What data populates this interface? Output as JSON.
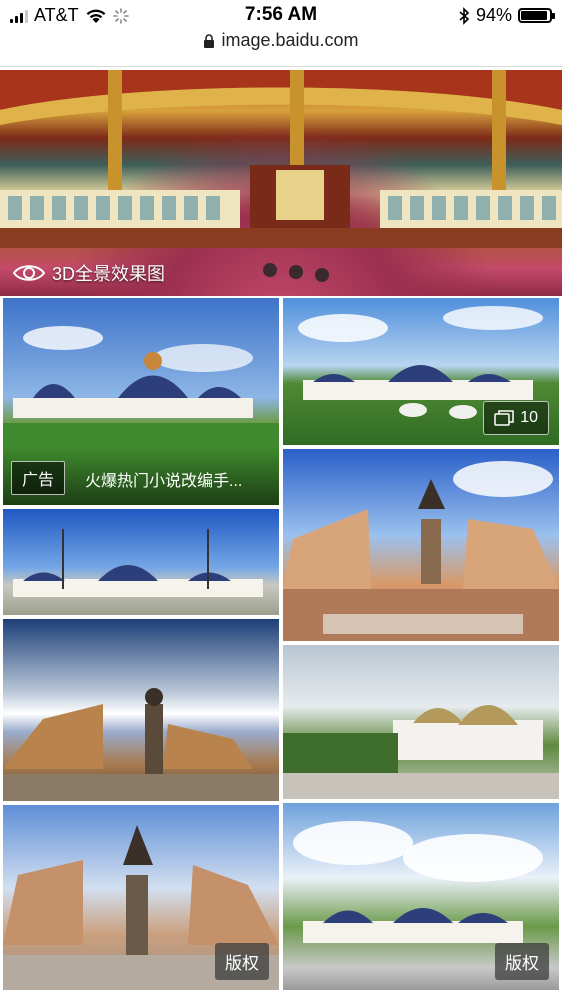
{
  "status_bar": {
    "carrier": "AT&T",
    "time": "7:56 AM",
    "battery": "94%",
    "battery_level": 0.94
  },
  "url_bar": {
    "url": "image.baidu.com"
  },
  "panorama": {
    "label": "3D全景效果图"
  },
  "tiles": {
    "ad": {
      "badge": "广告",
      "text": "火爆热门小说改编手..."
    },
    "gallery": {
      "count": "10"
    },
    "copyright_1": "版权",
    "copyright_2": "版权"
  },
  "colors": {
    "accent_text": "#ffffff",
    "divider": "#d9d9d9"
  }
}
